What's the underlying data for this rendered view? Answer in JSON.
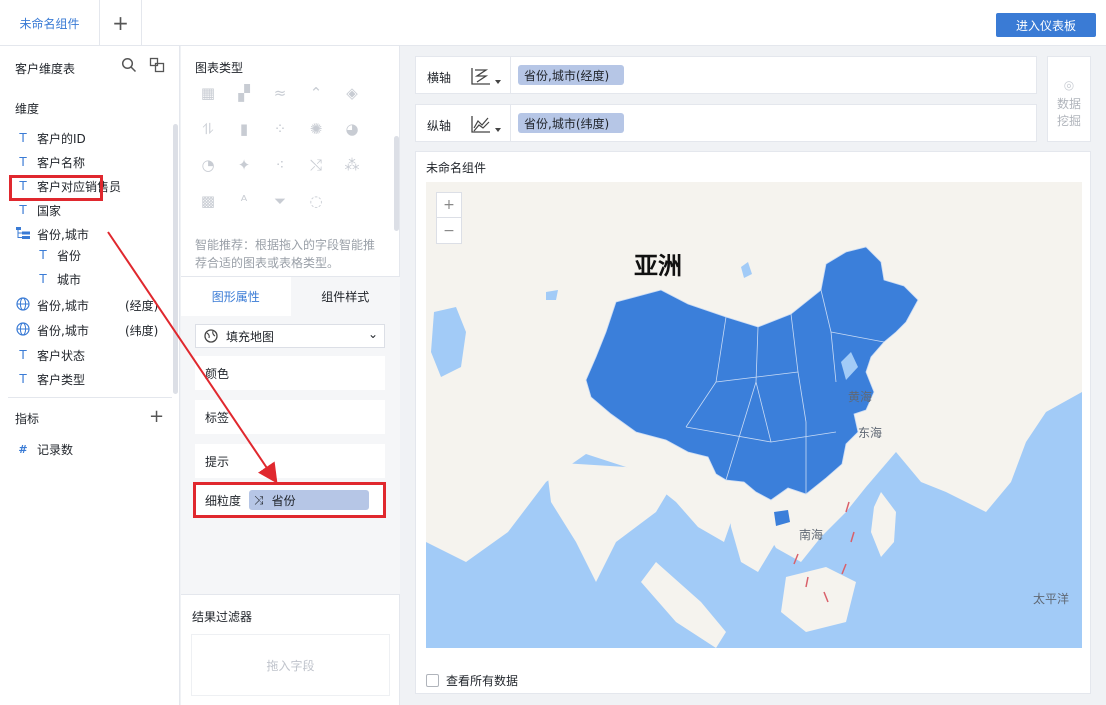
{
  "topbar": {
    "tab_label": "未命名组件",
    "add_tab": "+",
    "enter_dashboard": "进入仪表板"
  },
  "left": {
    "dataset_title": "客户维度表",
    "dimension_title": "维度",
    "dimensions": [
      {
        "icon": "T",
        "label": "客户的ID"
      },
      {
        "icon": "T",
        "label": "客户名称"
      },
      {
        "icon": "T",
        "label": "客户对应销售员"
      },
      {
        "icon": "T",
        "label": "国家"
      },
      {
        "icon": "hierarchy",
        "label": "省份,城市"
      },
      {
        "icon": "T",
        "label": "省份"
      },
      {
        "icon": "T",
        "label": "城市"
      },
      {
        "icon": "globe",
        "label": "省份,城市",
        "suffix": "(经度)"
      },
      {
        "icon": "globe",
        "label": "省份,城市",
        "suffix": "(纬度)"
      },
      {
        "icon": "T",
        "label": "客户状态"
      },
      {
        "icon": "T",
        "label": "客户类型"
      }
    ],
    "metric_title": "指标",
    "metric_add": "+",
    "metrics": [
      {
        "icon": "#",
        "label": "记录数"
      }
    ]
  },
  "middle": {
    "chart_type_title": "图表类型",
    "smart_recommend": "智能推荐：根据拖入的字段智能推荐合适的图表或表格类型。",
    "tabs": [
      "图形属性",
      "组件样式"
    ],
    "map_type": "填充地图",
    "props": [
      "颜色",
      "标签",
      "提示"
    ],
    "granularity_label": "细粒度",
    "granularity_value": "省份",
    "filter_title": "结果过滤器",
    "filter_placeholder": "拖入字段"
  },
  "axes": {
    "x_label": "横轴",
    "x_field": "省份,城市(经度)",
    "y_label": "纵轴",
    "y_field": "省份,城市(纬度)"
  },
  "mining": {
    "line1": "数据",
    "line2": "挖掘"
  },
  "card": {
    "title": "未命名组件",
    "zoom_in": "+",
    "zoom_out": "−",
    "continent": "亚洲",
    "labels": {
      "yellow_sea": "黄海",
      "east_sea": "东海",
      "south_sea": "南海",
      "pacific": "太平洋"
    },
    "view_all": "查看所有数据"
  },
  "colors": {
    "accent": "#3a7bd5",
    "map_fill": "#3b7fda",
    "ocean": "#a2cbf7",
    "land": "#f5f3ee",
    "highlight": "#e0282e"
  }
}
